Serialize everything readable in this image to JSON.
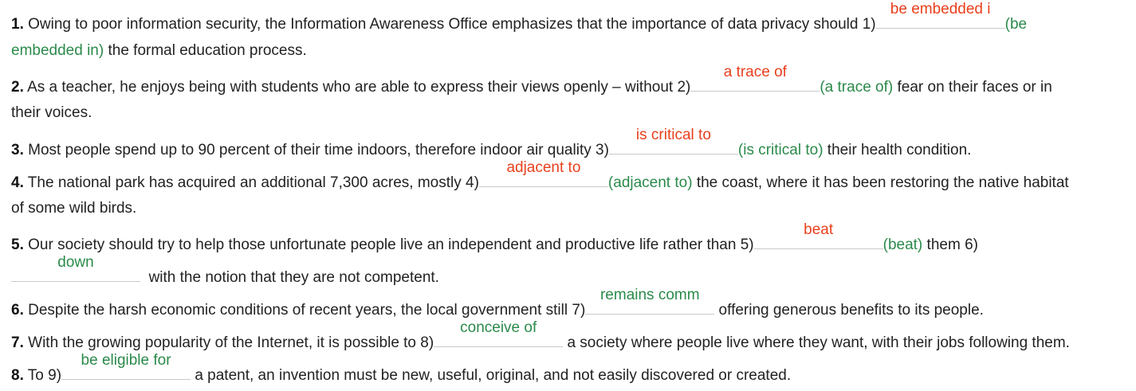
{
  "colors": {
    "wrong_answer": "#e8401c",
    "correct_answer": "#2b8a4b"
  },
  "items": [
    {
      "num": "1.",
      "before": " Owing to poor information security, the Information Awareness Office emphasizes that the importance of data privacy should 1)",
      "answer": "be embedded i",
      "hint_a": "(be",
      "hint_b": "embedded in)",
      "after": " the formal education process."
    },
    {
      "num": "2.",
      "before": " As a teacher, he enjoys being with students who are able to express their views openly – without 2)",
      "answer": "a trace of",
      "hint": "(a trace of)",
      "after_a": " fear on their faces or in",
      "after_b": "their voices."
    },
    {
      "num": "3.",
      "before": " Most people spend up to 90 percent of their time indoors, therefore indoor air quality 3)",
      "answer": "is critical to",
      "hint": "(is critical to)",
      "after": " their health condition."
    },
    {
      "num": "4.",
      "before": " The national park has acquired an additional 7,300 acres, mostly 4)",
      "answer": "adjacent to",
      "hint": "(adjacent to)",
      "after_a": " the coast, where it has been restoring the native habitat",
      "after_b": "of some wild birds."
    },
    {
      "num": "5.",
      "before": " Our society should try to help those unfortunate people live an independent and productive life rather than 5)",
      "answer": "beat",
      "hint": "(beat)",
      "middle": " them 6)",
      "answer2": "down",
      "after": "with the notion that they are not competent."
    },
    {
      "num": "6.",
      "before": " Despite the harsh economic conditions of recent years, the local government still 7)",
      "answer": "remains comm",
      "after": " offering generous benefits to its people."
    },
    {
      "num": "7.",
      "before": " With the growing popularity of the Internet, it is possible to 8)",
      "answer": "conceive of",
      "after": " a society where people live where they want, with their jobs following them."
    },
    {
      "num": "8.",
      "before": " To 9)",
      "answer": "be eligible for",
      "after": " a patent, an invention must be new, useful, original, and not easily discovered or created."
    }
  ]
}
